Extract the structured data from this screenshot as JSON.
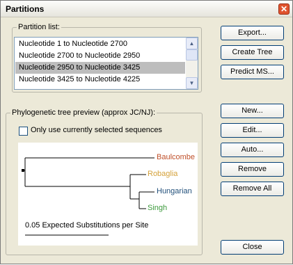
{
  "window": {
    "title": "Partitions",
    "close_symbol": "✕"
  },
  "partition_list": {
    "label": "Partition list:",
    "items": [
      "Nucleotide 1 to Nucleotide 2700",
      "Nucleotide 2700 to Nucleotide 2950",
      "Nucleotide 2950 to Nucleotide 3425",
      "Nucleotide 3425 to Nucleotide 4225"
    ],
    "selected_index": 2,
    "scroll_up": "▲",
    "scroll_down": "▼"
  },
  "buttons_top": {
    "export": "Export...",
    "create_tree": "Create Tree",
    "predict_ms": "Predict MS..."
  },
  "tree_preview": {
    "label": "Phylogenetic tree preview (approx JC/NJ):",
    "only_selected_label": "Only use currently selected sequences",
    "only_selected_checked": false,
    "leaves": [
      {
        "name": "Baulcombe",
        "color": "#c0502a"
      },
      {
        "name": "Robaglia",
        "color": "#d4a13a"
      },
      {
        "name": "Hungarian",
        "color": "#1f4e79"
      },
      {
        "name": "Singh",
        "color": "#3d9a3d"
      }
    ],
    "scale_label": "0.05 Expected Substitutions per Site"
  },
  "buttons_side": {
    "new": "New...",
    "edit": "Edit...",
    "auto": "Auto...",
    "remove": "Remove",
    "remove_all": "Remove All"
  },
  "close_button": "Close"
}
